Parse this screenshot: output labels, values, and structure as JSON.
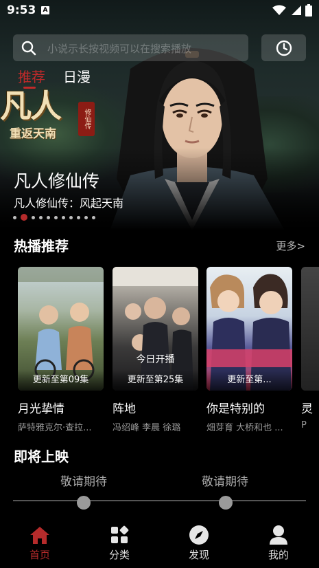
{
  "status_bar": {
    "time": "9:53",
    "badge": "A"
  },
  "search": {
    "placeholder": "小说示长按视频可以在搜索播放"
  },
  "top_tabs": [
    {
      "label": "推荐",
      "active": true
    },
    {
      "label": "日漫",
      "active": false
    }
  ],
  "banner": {
    "logo_main": "凡人",
    "logo_sub": "重返天南",
    "logo_seal": "修仙传",
    "title": "凡人修仙传",
    "subtitle": "凡人修仙传：风起天南",
    "dot_count": 11,
    "active_dot": 1
  },
  "hot": {
    "title": "热播推荐",
    "more": "更多>",
    "cards": [
      {
        "title": "月光挚情",
        "update": "更新至第09集",
        "cast": "萨特雅克尔·查拉...",
        "poster_text": ""
      },
      {
        "title": "阵地",
        "update": "更新至第25集",
        "cast": "冯绍峰  李晨  徐璐",
        "poster_text": "今日开播"
      },
      {
        "title": "你是特别的",
        "update": "更新至第...",
        "cast": "畑芽育  大桥和也  ...",
        "poster_text": ""
      },
      {
        "title": "灵",
        "update": "",
        "cast": "P",
        "poster_text": ""
      }
    ]
  },
  "coming": {
    "title": "即将上映",
    "items": [
      {
        "label": "敬请期待"
      },
      {
        "label": "敬请期待"
      }
    ]
  },
  "nav": [
    {
      "label": "首页",
      "icon": "home-icon",
      "active": true
    },
    {
      "label": "分类",
      "icon": "category-icon",
      "active": false
    },
    {
      "label": "发现",
      "icon": "compass-icon",
      "active": false
    },
    {
      "label": "我的",
      "icon": "user-icon",
      "active": false
    }
  ],
  "colors": {
    "accent": "#b52b2b",
    "background": "#000000"
  }
}
